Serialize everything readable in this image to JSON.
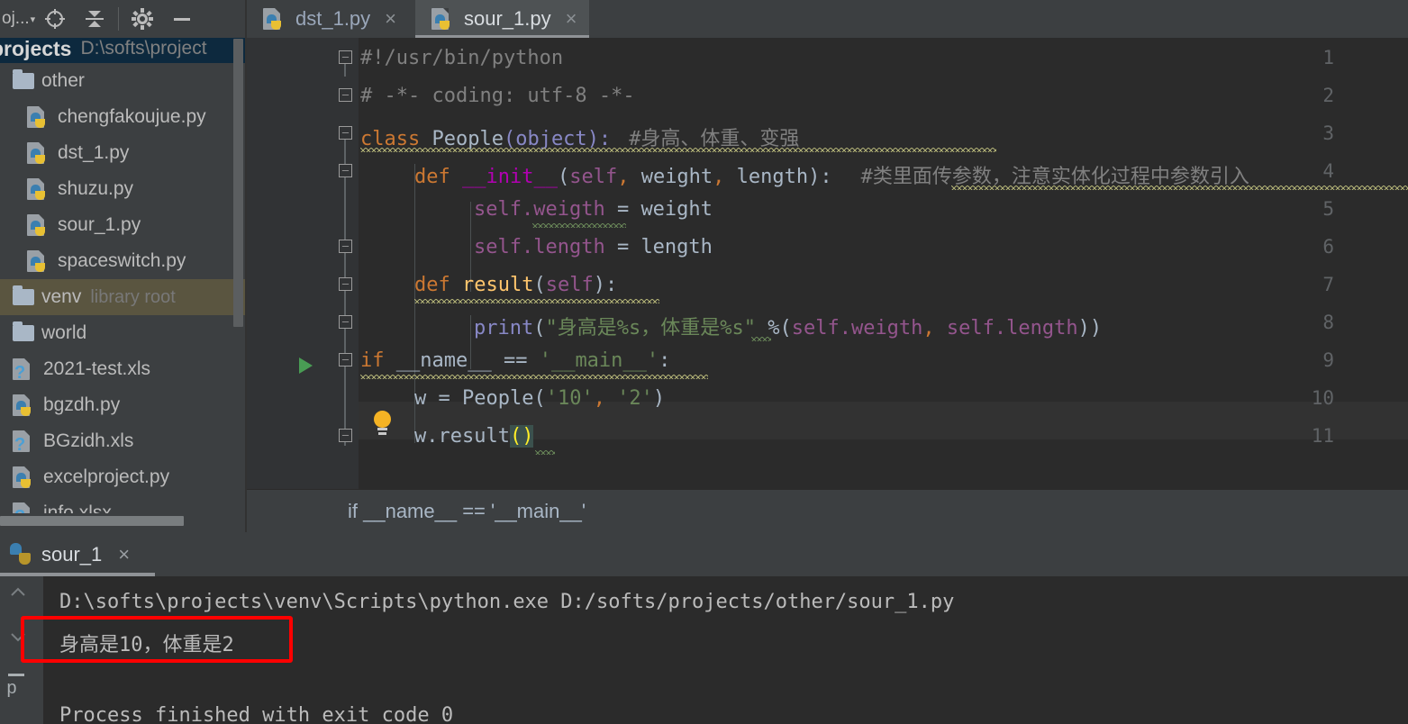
{
  "window": {
    "theme": "darcula",
    "accent_red": "#ff0000",
    "panel_bg": "#3c3f41",
    "editor_bg": "#2b2b2b"
  },
  "project_panel": {
    "toolbar": {
      "title": "oj...",
      "caret": "▾",
      "icons": [
        "locate-icon",
        "collapse-all-icon",
        "settings-gear-icon",
        "minimize-icon"
      ]
    },
    "root": {
      "name": "projects",
      "path": "D:\\softs\\project"
    },
    "items": [
      {
        "label": "other",
        "icon": "folder-icon",
        "indent": 1,
        "sub": "",
        "selected": false
      },
      {
        "label": "chengfakoujue.py",
        "icon": "python-file-icon",
        "indent": 2,
        "sub": "",
        "selected": false
      },
      {
        "label": "dst_1.py",
        "icon": "python-file-icon",
        "indent": 2,
        "sub": "",
        "selected": false
      },
      {
        "label": "shuzu.py",
        "icon": "python-file-icon",
        "indent": 2,
        "sub": "",
        "selected": false
      },
      {
        "label": "sour_1.py",
        "icon": "python-file-icon",
        "indent": 2,
        "sub": "",
        "selected": false
      },
      {
        "label": "spaceswitch.py",
        "icon": "python-file-icon",
        "indent": 2,
        "sub": "",
        "selected": false
      },
      {
        "label": "venv",
        "icon": "folder-icon",
        "indent": 1,
        "sub": "library root",
        "selected": true
      },
      {
        "label": "world",
        "icon": "folder-icon",
        "indent": 1,
        "sub": "",
        "selected": false
      },
      {
        "label": "2021-test.xls",
        "icon": "unknown-file-icon",
        "indent": 1,
        "sub": "",
        "selected": false
      },
      {
        "label": "bgzdh.py",
        "icon": "python-file-icon",
        "indent": 1,
        "sub": "",
        "selected": false
      },
      {
        "label": "BGzidh.xls",
        "icon": "unknown-file-icon",
        "indent": 1,
        "sub": "",
        "selected": false
      },
      {
        "label": "excelproject.py",
        "icon": "python-file-icon",
        "indent": 1,
        "sub": "",
        "selected": false
      },
      {
        "label": "info.xlsx",
        "icon": "unknown-file-icon",
        "indent": 1,
        "sub": "",
        "selected": false
      }
    ]
  },
  "editor": {
    "tabs": [
      {
        "label": "dst_1.py",
        "icon": "python-file-icon",
        "active": false,
        "close": "×"
      },
      {
        "label": "sour_1.py",
        "icon": "python-file-icon",
        "active": true,
        "close": "×"
      }
    ],
    "line_numbers": [
      "1",
      "2",
      "3",
      "4",
      "5",
      "6",
      "7",
      "8",
      "9",
      "10",
      "11"
    ],
    "code": {
      "l1": "#!/usr/bin/python",
      "l2": "# -*- coding: utf-8 -*-",
      "l3_kw": "class",
      "l3_name": " People",
      "l3_paren_open": "(",
      "l3_base": "object",
      "l3_tail": "):",
      "l3_comment": "#身高、体重、变强",
      "l4_kw": "def",
      "l4_name": " __init__",
      "l4_open": "(",
      "l4_self": "self",
      "l4_c1": ",",
      "l4_p1": " weight",
      "l4_c2": ",",
      "l4_p2": " length",
      "l4_tail": "):",
      "l4_comment": "#类里面传参数，注意实体化过程中参数引入",
      "l5_self": "self",
      "l5_attr": ".weigth",
      "l5_rest": " = weight",
      "l6_self": "self",
      "l6_attr": ".length",
      "l6_rest": " = length",
      "l7_kw": "def",
      "l7_name": " result",
      "l7_open": "(",
      "l7_self": "self",
      "l7_tail": "):",
      "l8_print": "print",
      "l8_open": "(",
      "l8_str": "\"身高是%s，体重是%s\"",
      "l8_pct": " %(",
      "l8_s1": "self",
      "l8_a1": ".weigth",
      "l8_c1": ",",
      "l8_s2": " self",
      "l8_a2": ".length",
      "l8_close": "))",
      "l9_kw": "if",
      "l9_dunder": " __name__",
      "l9_eq": " == ",
      "l9_str": "'__main__'",
      "l9_colon": ":",
      "l10_var": "w = People(",
      "l10_s1": "'10'",
      "l10_c": ",",
      "l10_s2": " '2'",
      "l10_close": ")",
      "l11_call": "w.result",
      "l11_parens": "()"
    },
    "breadcrumb": "if __name__ == '__main__'"
  },
  "console": {
    "tab_label": "sour_1",
    "tab_icon": "python-icon",
    "tab_close": "×",
    "side_icons": [
      "chevron-up-icon",
      "chevron-down-icon",
      "soft-wrap-icon"
    ],
    "lines": [
      "D:\\softs\\projects\\venv\\Scripts\\python.exe D:/softs/projects/other/sour_1.py",
      "身高是10，体重是2",
      "",
      "Process finished with exit code 0"
    ],
    "highlighted_line_index": 1
  }
}
